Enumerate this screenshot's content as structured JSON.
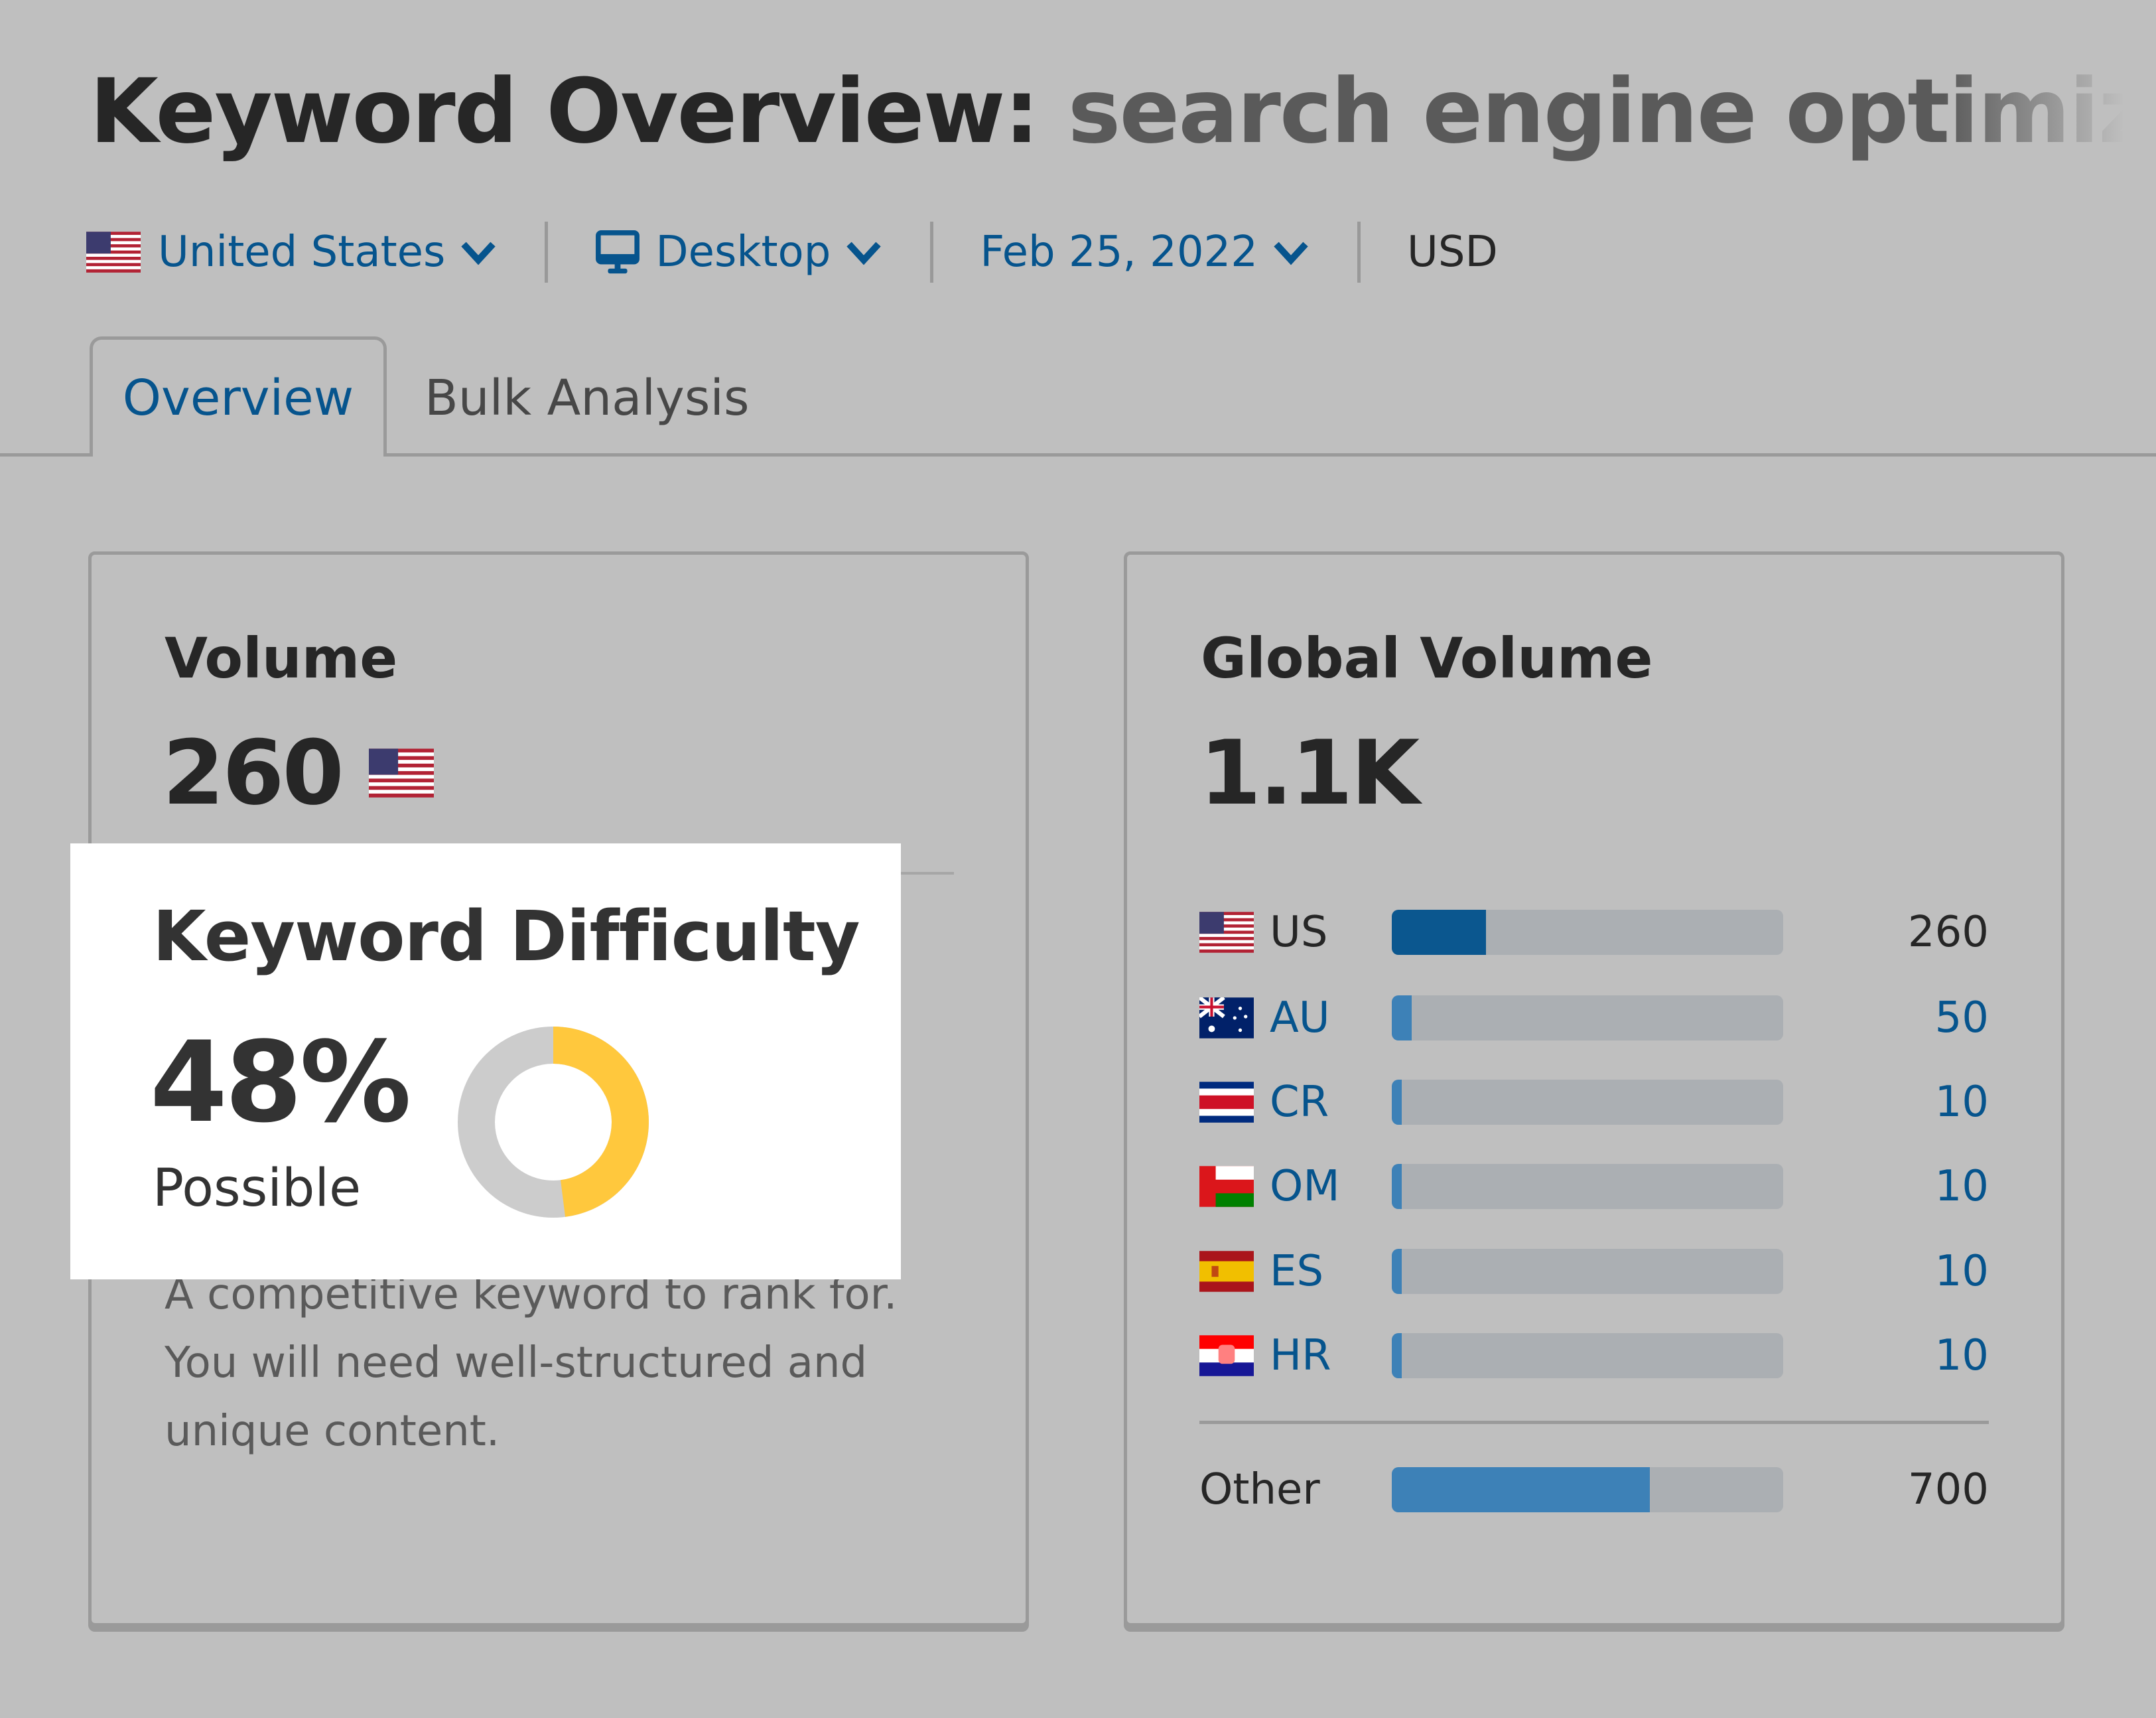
{
  "header": {
    "title_prefix": "Keyword Overview:",
    "keyword": "search engine optimization"
  },
  "filters": {
    "country": {
      "label": "United States",
      "icon": "us-flag-icon"
    },
    "device": {
      "label": "Desktop",
      "icon": "desktop-icon"
    },
    "date": {
      "label": "Feb 25, 2022"
    },
    "currency": {
      "label": "USD"
    }
  },
  "tabs": [
    {
      "label": "Overview",
      "active": true
    },
    {
      "label": "Bulk Analysis",
      "active": false
    }
  ],
  "volume_card": {
    "title": "Volume",
    "value": "260",
    "flag": "us-flag-icon",
    "description": "A competitive keyword to rank for. You will need well-structured and unique content."
  },
  "keyword_difficulty": {
    "title": "Keyword Difficulty",
    "value": "48%",
    "percent": 48,
    "label": "Possible",
    "colors": {
      "filled": "#ffc83d",
      "empty": "#cccccc"
    }
  },
  "global_volume_card": {
    "title": "Global Volume",
    "value": "1.1K",
    "countries": [
      {
        "code": "US",
        "flag": "us-flag-icon",
        "value": "260",
        "share": 0.24,
        "primary": true
      },
      {
        "code": "AU",
        "flag": "au-flag-icon",
        "value": "50",
        "share": 0.05,
        "primary": false
      },
      {
        "code": "CR",
        "flag": "cr-flag-icon",
        "value": "10",
        "share": 0.01,
        "primary": false
      },
      {
        "code": "OM",
        "flag": "om-flag-icon",
        "value": "10",
        "share": 0.01,
        "primary": false
      },
      {
        "code": "ES",
        "flag": "es-flag-icon",
        "value": "10",
        "share": 0.01,
        "primary": false
      },
      {
        "code": "HR",
        "flag": "hr-flag-icon",
        "value": "10",
        "share": 0.01,
        "primary": false
      }
    ],
    "other": {
      "label": "Other",
      "value": "700",
      "share": 0.66
    },
    "colors": {
      "primary_bar": "#0b578f",
      "secondary_bar": "#3d81b7",
      "track": "#abafb3",
      "link": "#06548d"
    }
  }
}
